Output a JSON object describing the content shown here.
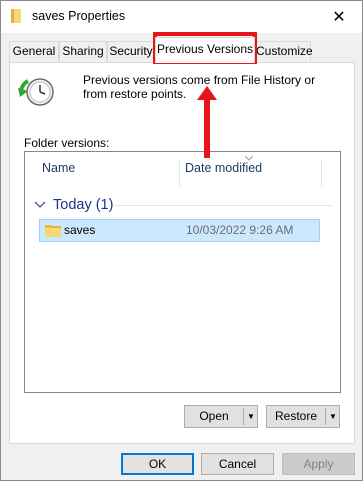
{
  "window": {
    "title": "saves Properties",
    "close_symbol": "✕"
  },
  "tabs": [
    {
      "label": "General"
    },
    {
      "label": "Sharing"
    },
    {
      "label": "Security"
    },
    {
      "label": "Previous Versions"
    },
    {
      "label": "Customize"
    }
  ],
  "active_tab": "Previous Versions",
  "content": {
    "description": "Previous versions come from File History or from restore points.",
    "folder_versions_label": "Folder versions:"
  },
  "list": {
    "columns": [
      {
        "label": "Name"
      },
      {
        "label": "Date modified"
      }
    ],
    "groups": [
      {
        "label": "Today (1)",
        "items": [
          {
            "name": "saves",
            "date_modified": "10/03/2022 9:26 AM",
            "selected": true
          }
        ]
      }
    ]
  },
  "actions": {
    "open_label": "Open",
    "restore_label": "Restore",
    "dropdown_symbol": "▼"
  },
  "footer": {
    "ok_label": "OK",
    "cancel_label": "Cancel",
    "apply_label": "Apply"
  },
  "icons": {
    "title": "folder-icon",
    "previous_versions": "clock-restore-icon",
    "row": "folder-icon"
  },
  "colors": {
    "highlight": "#e8141c",
    "selection_bg": "#cce8ff",
    "selection_border": "#99d1ff",
    "group_header": "#1e3287",
    "default_button_border": "#0078d7"
  }
}
